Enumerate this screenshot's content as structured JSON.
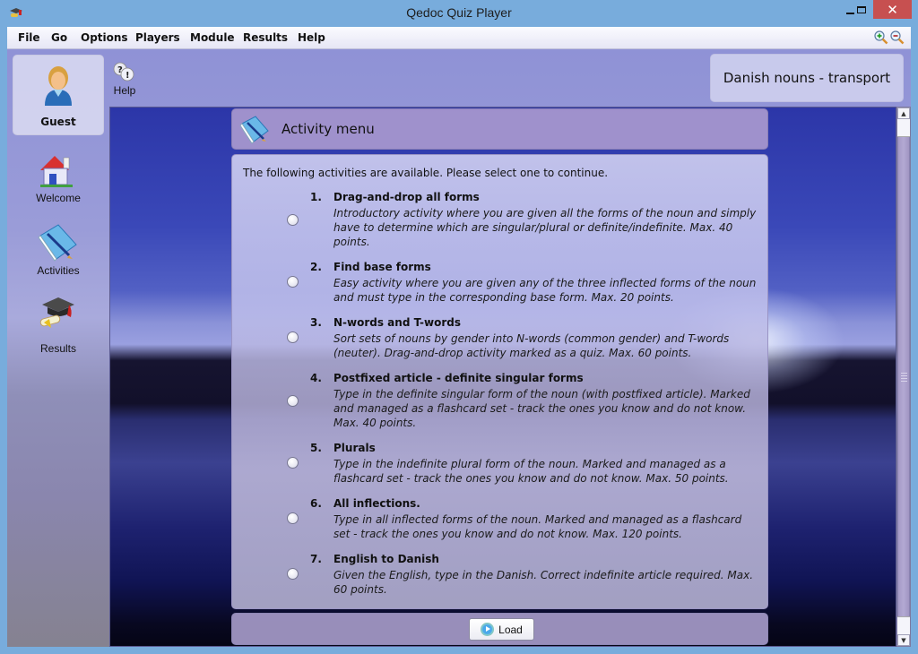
{
  "window": {
    "title": "Qedoc Quiz Player",
    "controls": {
      "minimize": "_",
      "maximize": "☐",
      "close": "✕"
    }
  },
  "menubar": {
    "items": [
      {
        "label": "File"
      },
      {
        "label": "Go"
      },
      {
        "label": "Options"
      },
      {
        "label": "Players"
      },
      {
        "label": "Module"
      },
      {
        "label": "Results"
      },
      {
        "label": "Help"
      }
    ],
    "zoom_in_icon": "zoom-in-icon",
    "zoom_out_icon": "zoom-out-icon"
  },
  "sidebar": {
    "user": {
      "name": "Guest",
      "icon": "user-avatar-icon"
    },
    "items": [
      {
        "label": "Welcome",
        "icon": "house-icon"
      },
      {
        "label": "Activities",
        "icon": "book-pen-icon"
      },
      {
        "label": "Results",
        "icon": "graduation-cap-icon"
      }
    ]
  },
  "toolbar": {
    "help_label": "Help",
    "help_icon": "help-bubbles-icon"
  },
  "module": {
    "title": "Danish nouns - transport"
  },
  "activity_menu": {
    "title": "Activity menu",
    "intro": "The following activities are available. Please select one to continue.",
    "activities": [
      {
        "num": "1.",
        "title": "Drag-and-drop all forms",
        "desc": "Introductory activity where you are given all the forms of the noun and simply have to determine which are singular/plural or definite/indefinite. Max. 40 points.",
        "selected": false
      },
      {
        "num": "2.",
        "title": "Find base forms",
        "desc": "Easy activity where you are given any of the three inflected forms of the noun and must type in the corresponding base form. Max. 20 points.",
        "selected": false
      },
      {
        "num": "3.",
        "title": "N-words and T-words",
        "desc": "Sort sets of nouns by gender into N-words (common gender) and T-words (neuter). Drag-and-drop activity marked as a quiz. Max. 60 points.",
        "selected": false
      },
      {
        "num": "4.",
        "title": "Postfixed article - definite singular forms",
        "desc": "Type in the definite singular form of the noun (with postfixed article). Marked and managed as a flashcard set - track the ones you know and do not know. Max. 40 points.",
        "selected": false
      },
      {
        "num": "5.",
        "title": "Plurals",
        "desc": "Type in the indefinite plural form of the noun. Marked and managed as a flashcard set - track the ones you know and do not know. Max. 50 points.",
        "selected": false
      },
      {
        "num": "6.",
        "title": "All inflections.",
        "desc": "Type in all inflected forms of the noun. Marked and managed as a flashcard set - track the ones you know and do not know. Max. 120 points.",
        "selected": false
      },
      {
        "num": "7.",
        "title": "English to Danish",
        "desc": "Given the English, type in the Danish. Correct indefinite article required. Max. 60 points.",
        "selected": false
      }
    ],
    "load_label": "Load"
  },
  "colors": {
    "title_bar": "#78acdc",
    "close_button": "#c75050",
    "panel_header": "#a596cd"
  }
}
